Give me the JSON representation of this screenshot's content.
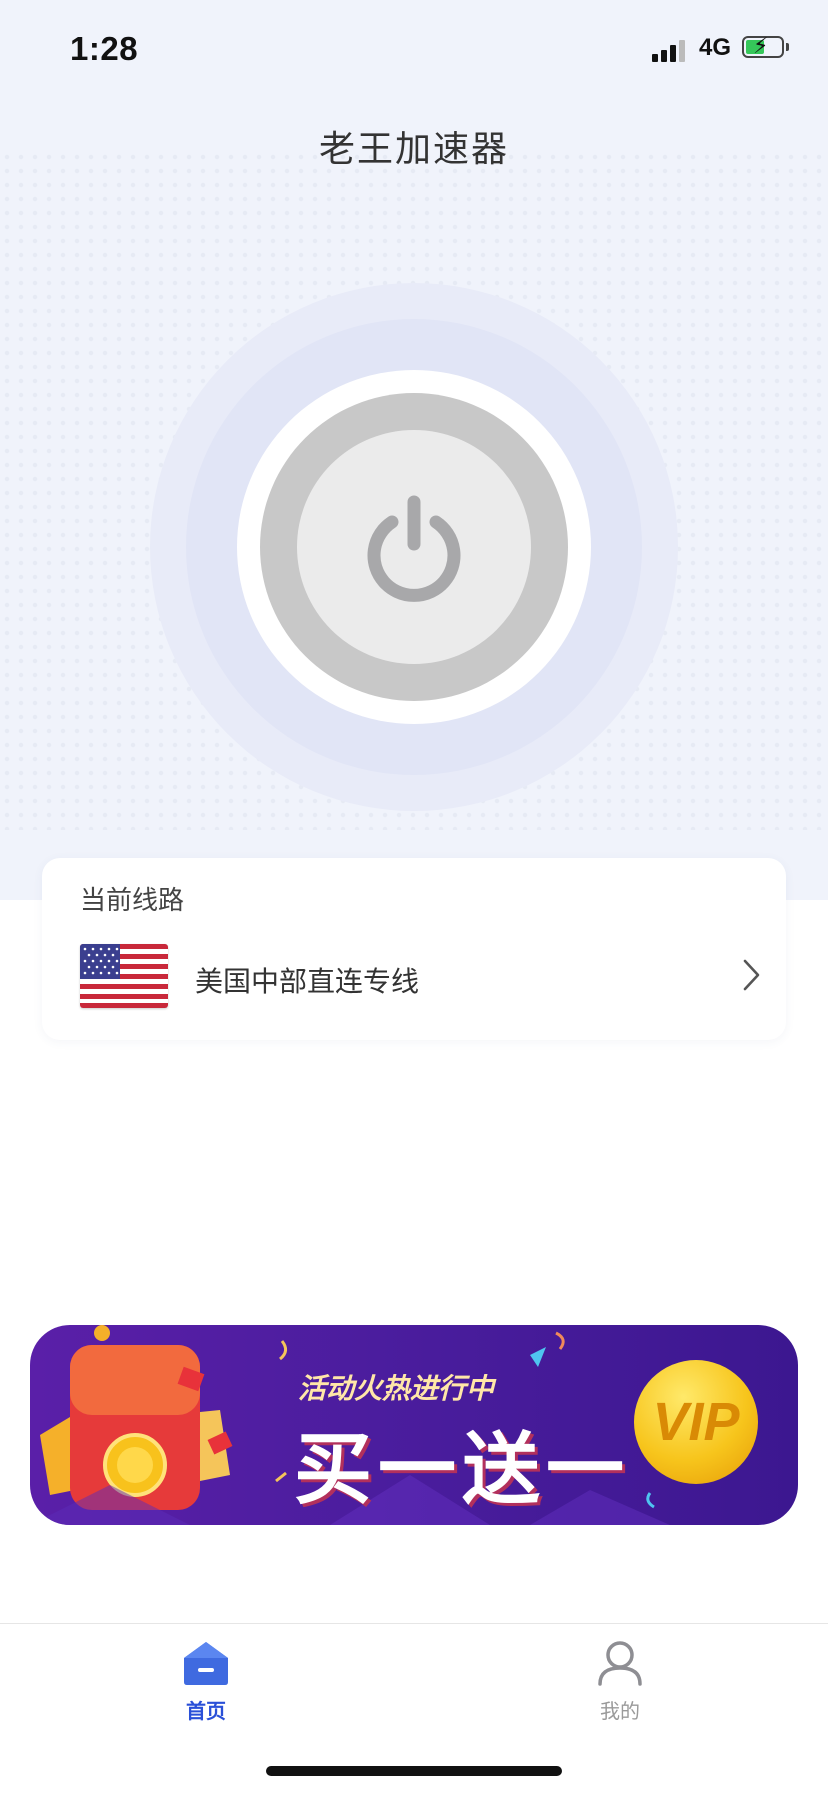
{
  "status_bar": {
    "time": "1:28",
    "network": "4G",
    "icons": [
      "signal-icon",
      "battery-charging-icon"
    ]
  },
  "header": {
    "title": "老王加速器"
  },
  "power": {
    "icon": "power-icon",
    "state": "off"
  },
  "route": {
    "label": "当前线路",
    "name": "美国中部直连专线",
    "flag_icon": "us-flag-icon",
    "chevron_icon": "chevron-right-icon"
  },
  "banner": {
    "subtitle": "活动火热进行中",
    "title": "买一送一",
    "badge": "VIP"
  },
  "tabs": [
    {
      "label": "首页",
      "icon": "home-icon",
      "active": true
    },
    {
      "label": "我的",
      "icon": "user-icon",
      "active": false
    }
  ],
  "colors": {
    "accent": "#2a50d8",
    "background_top": "#f0f3fb",
    "banner_purple": "#4b1d9e",
    "vip_gold": "#f7c51c"
  }
}
